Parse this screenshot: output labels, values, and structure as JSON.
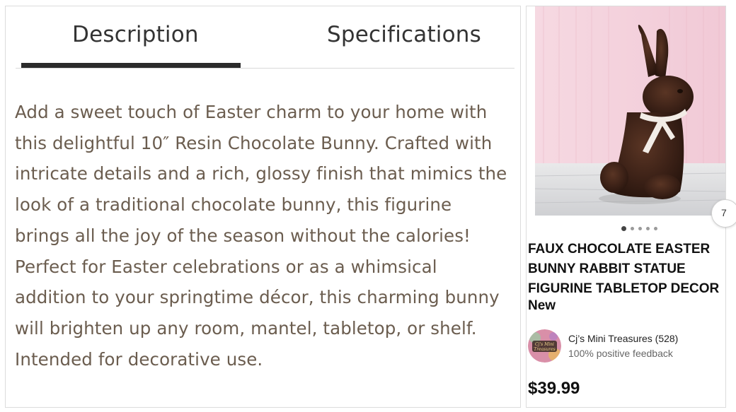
{
  "tabs": [
    {
      "label": "Description",
      "active": true
    },
    {
      "label": "Specifications",
      "active": false
    }
  ],
  "description": {
    "lines": [
      "Add a sweet touch of Easter charm to your home with",
      "this delightful 10″ Resin Chocolate Bunny. Crafted with",
      "intricate details and a rich, glossy finish that mimics the",
      "look of a traditional chocolate bunny, this figurine",
      "brings all the joy of the season without the calories!",
      "Perfect for Easter celebrations or as a whimsical",
      "addition to your springtime décor, this charming bunny",
      "will brighten up any room, mantel, tabletop, or shelf.",
      "Intended for decorative use."
    ]
  },
  "product_card": {
    "title_lines": [
      "FAUX CHOCOLATE EASTER",
      "BUNNY RABBIT STATUE",
      "FIGURINE TABLETOP DECOR"
    ],
    "condition": "New",
    "seller_name": "Cj’s Mini Treasures (528)",
    "seller_feedback": "100% positive feedback",
    "seller_logo_text": [
      "Cj's Mini",
      "Treasures"
    ],
    "price": "$39.99",
    "carousel": {
      "dot_count": 5,
      "active_index": 0
    },
    "next_button_label": "7"
  },
  "icons": {
    "product_image": "chocolate-bunny-photo",
    "next": "next-card-button"
  },
  "colors": {
    "description_text": "#6b5d4f",
    "tab_underline": "#2b2b2b",
    "image_background": "#f4d2dc"
  }
}
